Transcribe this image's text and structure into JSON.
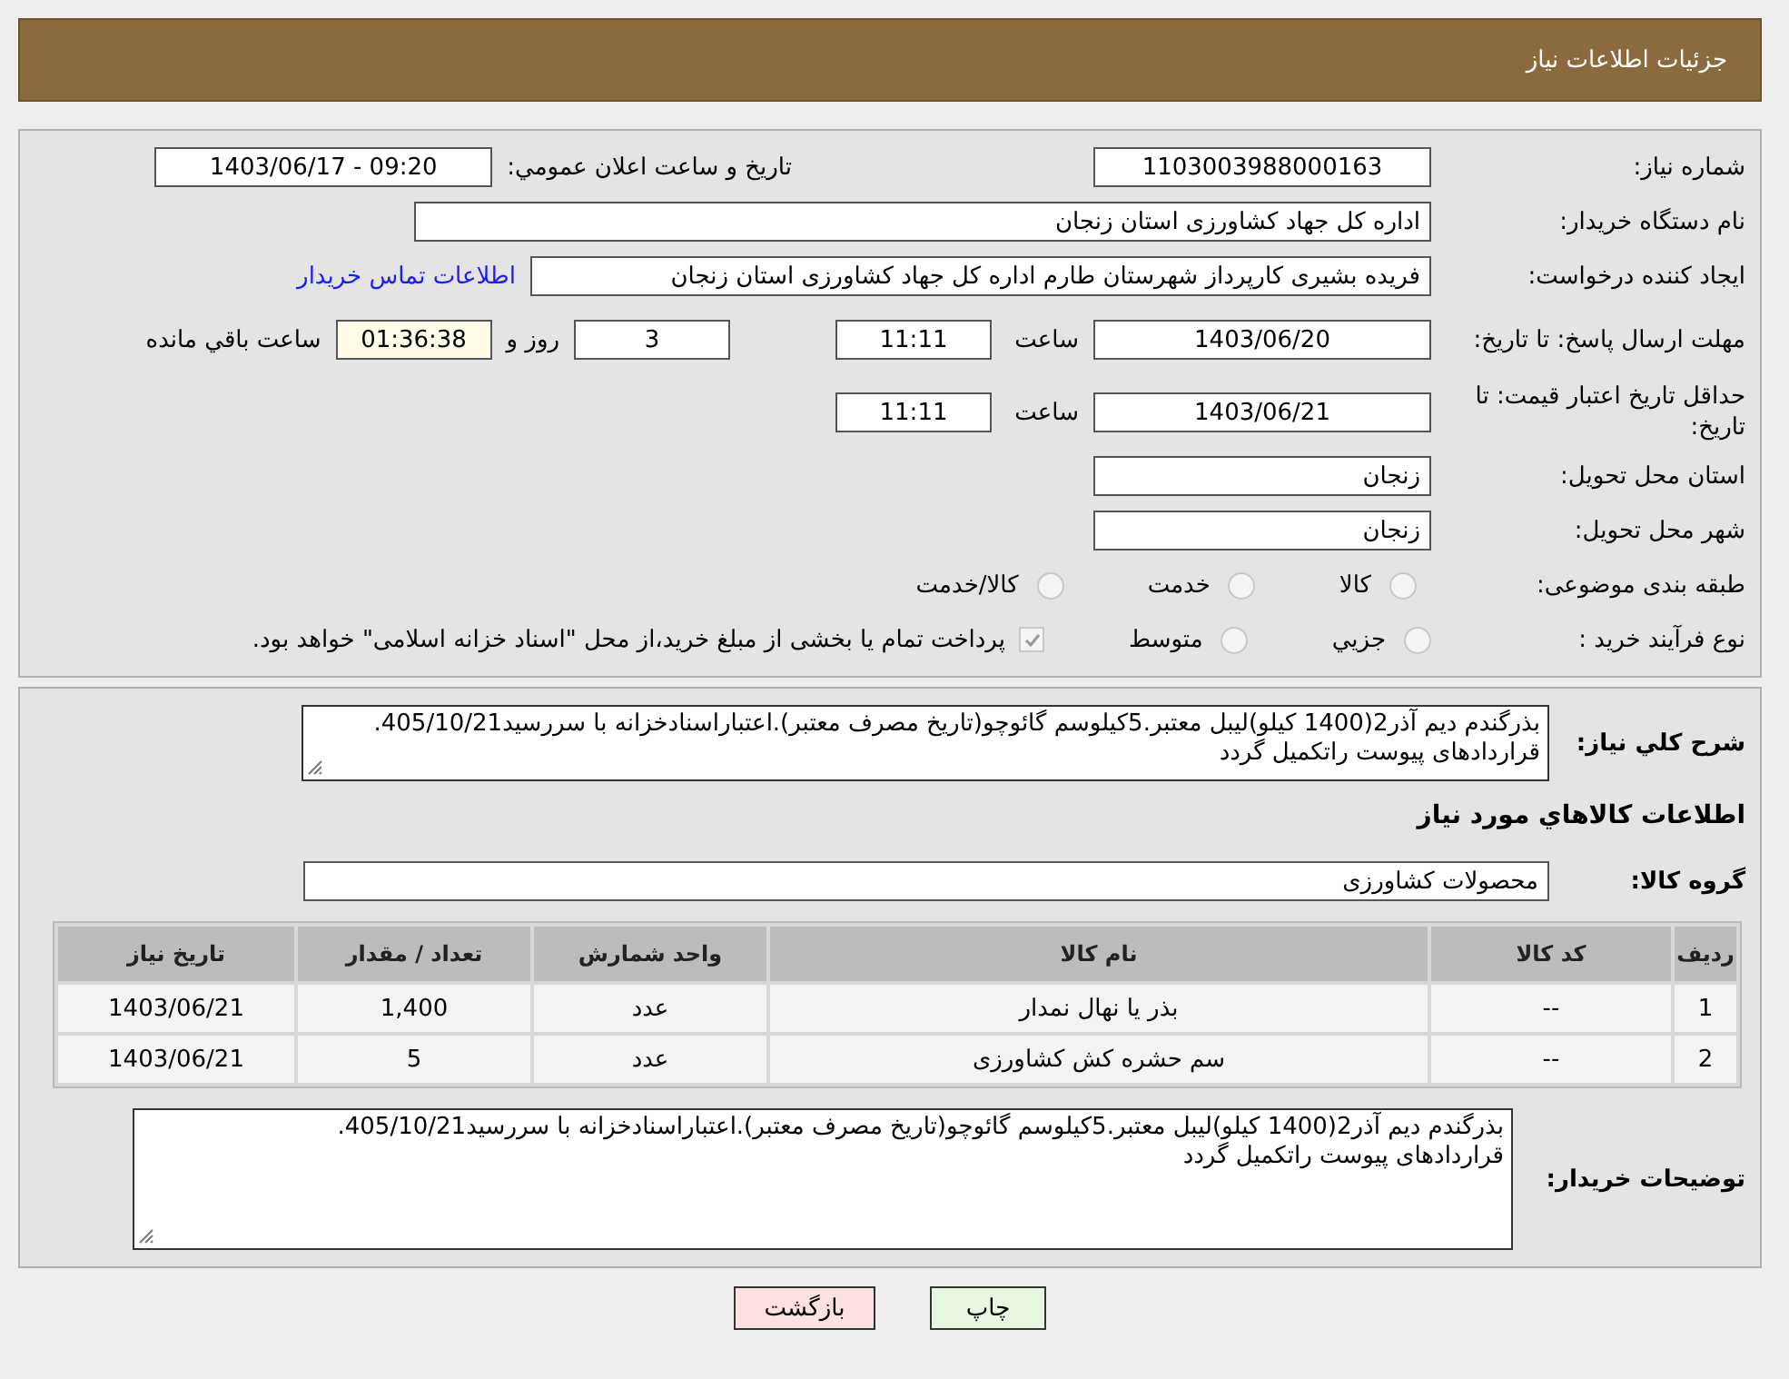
{
  "header": {
    "title": "جزئیات اطلاعات نیاز"
  },
  "need_number": {
    "label": "شماره نیاز:",
    "value": "1103003988000163"
  },
  "announce": {
    "label": "تاریخ و ساعت اعلان عمومي:",
    "value": "1403/06/17 - 09:20"
  },
  "buyer": {
    "label": "نام دستگاه خریدار:",
    "value": "اداره کل جهاد کشاورزی استان زنجان"
  },
  "creator": {
    "label": "ایجاد کننده درخواست:",
    "value": "فریده بشیری کارپرداز شهرستان طارم اداره کل جهاد کشاورزی استان زنجان",
    "link": "اطلاعات تماس خریدار"
  },
  "deadline": {
    "label": "مهلت ارسال پاسخ: تا تاریخ:",
    "date": "1403/06/20",
    "time_label": "ساعت",
    "time": "11:11",
    "days": "3",
    "days_label": "روز و",
    "remaining": "01:36:38",
    "remaining_label": "ساعت باقي مانده"
  },
  "validity": {
    "label": "حداقل تاریخ اعتبار قیمت: تا تاریخ:",
    "date": "1403/06/21",
    "time_label": "ساعت",
    "time": "11:11"
  },
  "province": {
    "label": "استان محل تحویل:",
    "value": "زنجان"
  },
  "city": {
    "label": "شهر محل تحویل:",
    "value": "زنجان"
  },
  "category": {
    "label": "طبقه بندی موضوعی:",
    "options": [
      {
        "label": "کالا",
        "selected": false
      },
      {
        "label": "خدمت",
        "selected": false
      },
      {
        "label": "کالا/خدمت",
        "selected": false
      }
    ]
  },
  "process": {
    "label": "نوع فرآیند خرید :",
    "options": [
      {
        "label": "جزيي",
        "selected": false
      },
      {
        "label": "متوسط",
        "selected": false
      }
    ],
    "payment": {
      "label": "پرداخت تمام یا بخشی از مبلغ خرید،از محل \"اسناد خزانه اسلامی\" خواهد بود.",
      "checked": true
    }
  },
  "summary": {
    "label": "شرح کلي نیاز:",
    "value": "بذرگندم دیم آذر2(1400 کیلو)لیبل معتبر.5کیلوسم گائوچو(تاریخ مصرف معتبر).اعتباراسنادخزانه با سررسید405/10/21. قراردادهای پیوست راتکمیل گردد"
  },
  "goods_title": "اطلاعات کالاهاي مورد نیاز",
  "goods_group": {
    "label": "گروه کالا:",
    "value": "محصولات کشاورزی"
  },
  "table": {
    "columns": [
      "ردیف",
      "کد کالا",
      "نام کالا",
      "واحد شمارش",
      "تعداد / مقدار",
      "تاریخ نیاز"
    ],
    "rows": [
      [
        "1",
        "--",
        "بذر یا نهال نمدار",
        "عدد",
        "1,400",
        "1403/06/21"
      ],
      [
        "2",
        "--",
        "سم حشره کش کشاورزی",
        "عدد",
        "5",
        "1403/06/21"
      ]
    ]
  },
  "notes": {
    "label": "توضیحات خریدار:",
    "value": "بذرگندم دیم آذر2(1400 کیلو)لیبل معتبر.5کیلوسم گائوچو(تاریخ مصرف معتبر).اعتباراسنادخزانه با سررسید405/10/21.\nقراردادهای پیوست راتکمیل گردد"
  },
  "buttons": [
    {
      "label": "چاپ",
      "kind": "print"
    },
    {
      "label": "بازگشت",
      "kind": "back"
    }
  ]
}
